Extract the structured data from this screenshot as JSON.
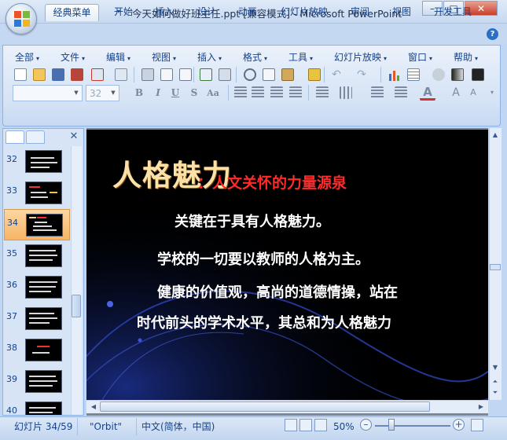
{
  "window": {
    "title": "今天如何做好班主任.ppt [兼容模式] - Microsoft PowerPoint",
    "controls": {
      "minimize": "–",
      "maximize": "□",
      "close": "✕"
    }
  },
  "ribbon_tabs": [
    "经典菜单",
    "开始",
    "插入",
    "设计",
    "动画",
    "幻灯片放映",
    "审阅",
    "视图",
    "开发工具"
  ],
  "help_label": "?",
  "menus": [
    "全部",
    "文件",
    "编辑",
    "视图",
    "插入",
    "格式",
    "工具",
    "幻灯片放映",
    "窗口",
    "帮助"
  ],
  "font": {
    "name": "",
    "size": "32"
  },
  "format_buttons": [
    "B",
    "I",
    "U",
    "S",
    "Aa"
  ],
  "thumbnails": [
    {
      "num": "32"
    },
    {
      "num": "33"
    },
    {
      "num": "34",
      "selected": true
    },
    {
      "num": "35"
    },
    {
      "num": "36"
    },
    {
      "num": "37"
    },
    {
      "num": "38"
    },
    {
      "num": "39"
    },
    {
      "num": "40"
    }
  ],
  "slide": {
    "title": "人格魅力",
    "subtitle": "：人文关怀的力量源泉",
    "lines": [
      "关键在于具有人格魅力。",
      "学校的一切要以教师的人格为主。",
      "健康的价值观，高尚的道德情操，站在",
      "时代前头的学术水平，其总和为人格魅力"
    ]
  },
  "status": {
    "slide_indicator": "幻灯片 34/59",
    "theme": "\"Orbit\"",
    "language": "中文(简体，中国)",
    "zoom": "50%",
    "zoom_minus": "–",
    "zoom_plus": "+"
  },
  "colors": {
    "ribbon_bg": "#d5e3f5",
    "slide_bg": "#000000",
    "slide_title": "#fbe1a6",
    "slide_subtitle": "#ff2a2a",
    "selected_thumb": "#f6b566"
  }
}
